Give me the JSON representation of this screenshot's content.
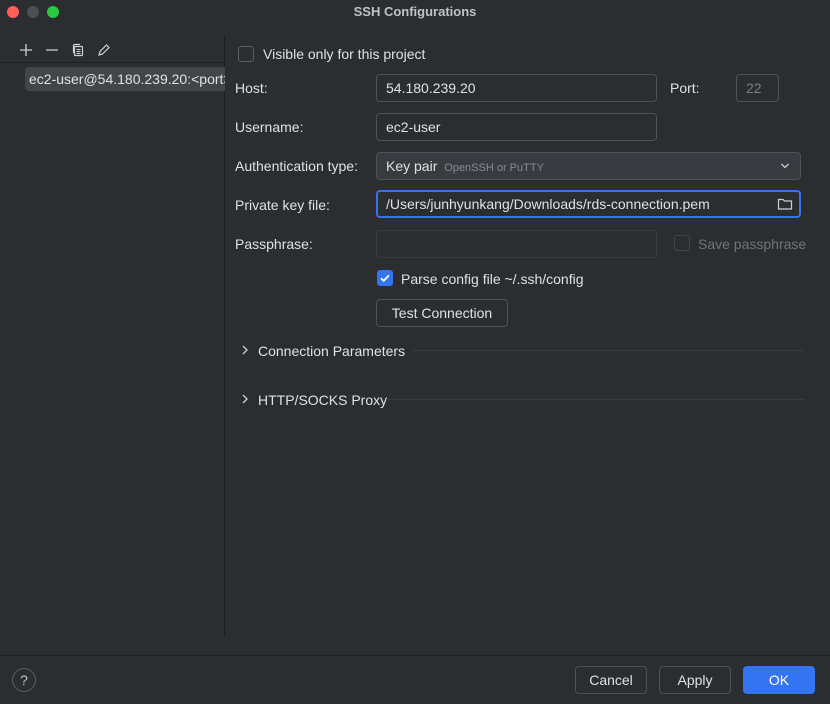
{
  "window": {
    "title": "SSH Configurations"
  },
  "sidebar": {
    "toolbar": {
      "add_icon": "plus-icon",
      "remove_icon": "minus-icon",
      "copy_icon": "copy-icon",
      "edit_icon": "pencil-icon"
    },
    "items": [
      {
        "label": "ec2-user@54.180.239.20:<port>"
      }
    ]
  },
  "form": {
    "visible_only_label": "Visible only for this project",
    "visible_only_checked": false,
    "host_label": "Host:",
    "host_value": "54.180.239.20",
    "port_label": "Port:",
    "port_value": "22",
    "username_label": "Username:",
    "username_value": "ec2-user",
    "auth_type_label": "Authentication type:",
    "auth_type_value": "Key pair",
    "auth_type_hint": "OpenSSH or PuTTY",
    "private_key_label": "Private key file:",
    "private_key_value": "/Users/junhyunkang/Downloads/rds-connection.pem",
    "passphrase_label": "Passphrase:",
    "passphrase_value": "",
    "save_passphrase_label": "Save passphrase",
    "parse_config_label": "Parse config file ~/.ssh/config",
    "parse_config_checked": true,
    "test_connection_label": "Test Connection"
  },
  "sections": [
    {
      "label": "Connection Parameters"
    },
    {
      "label": "HTTP/SOCKS Proxy"
    }
  ],
  "footer": {
    "help_label": "?",
    "cancel_label": "Cancel",
    "apply_label": "Apply",
    "ok_label": "OK"
  },
  "colors": {
    "accent": "#3574f0",
    "background": "#2b2d30",
    "text": "#dfe1e5"
  }
}
